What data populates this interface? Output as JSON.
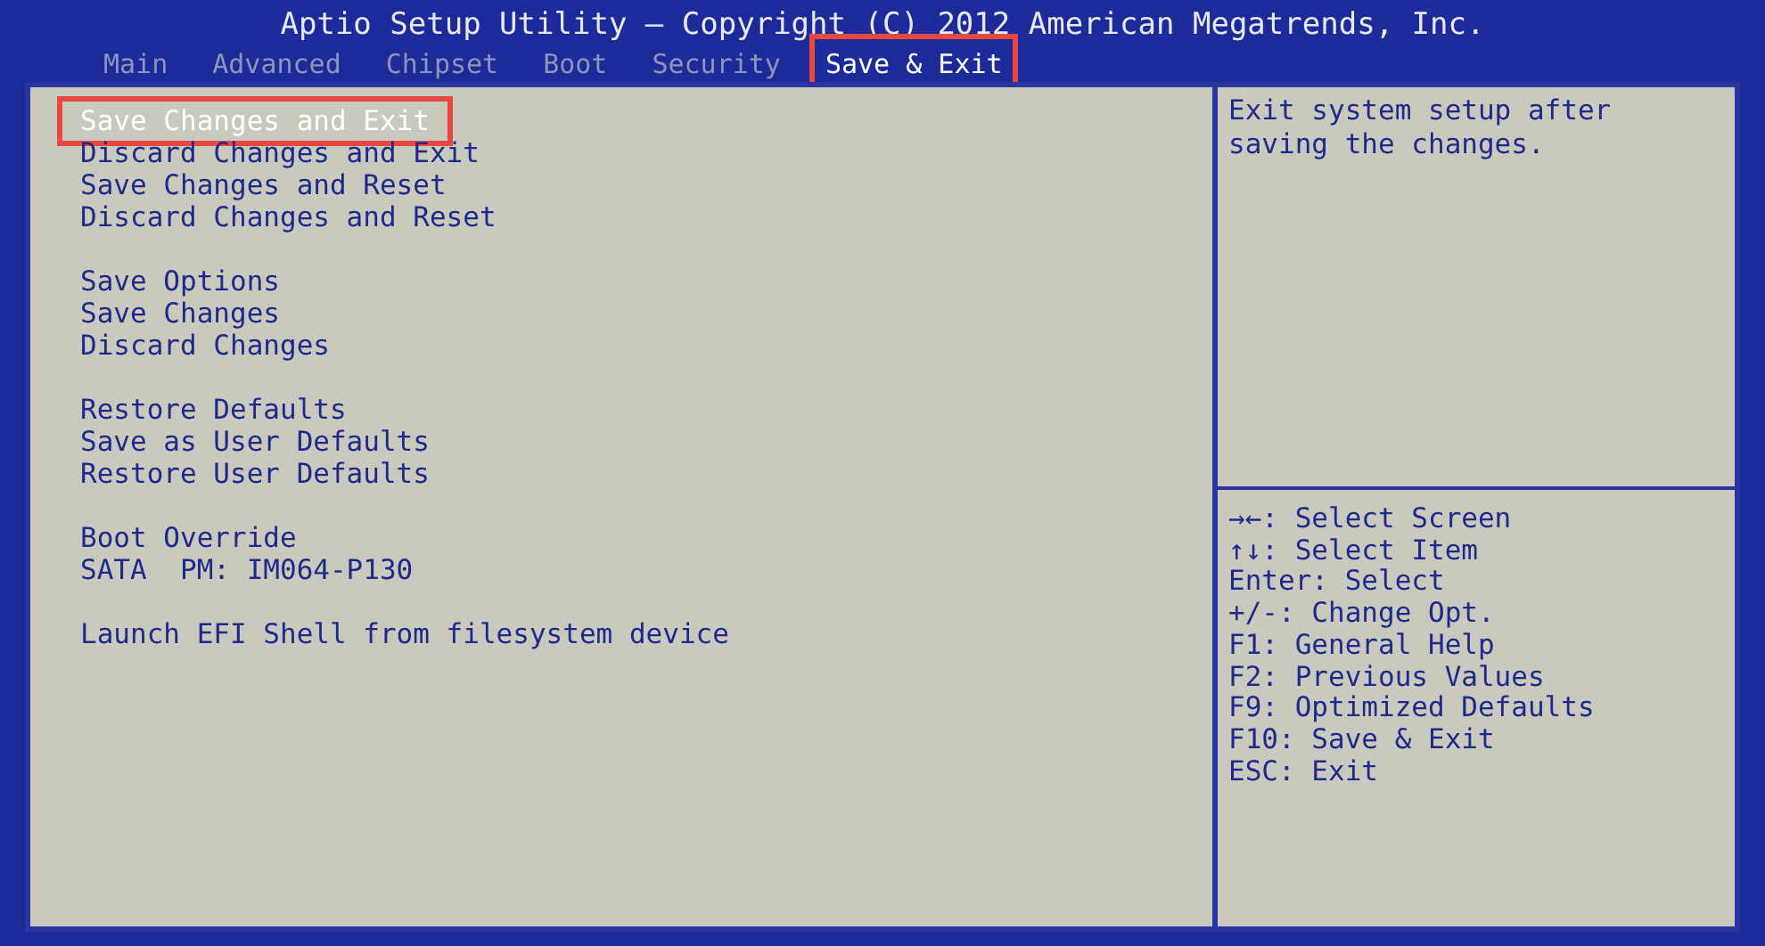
{
  "window": {
    "title": "Aptio Setup Utility – Copyright (C) 2012 American Megatrends, Inc."
  },
  "tabs": [
    {
      "label": "Main",
      "selected": false,
      "annotated": false
    },
    {
      "label": "Advanced",
      "selected": false,
      "annotated": false
    },
    {
      "label": "Chipset",
      "selected": false,
      "annotated": false
    },
    {
      "label": "Boot",
      "selected": false,
      "annotated": false
    },
    {
      "label": "Security",
      "selected": false,
      "annotated": false
    },
    {
      "label": "Save & Exit",
      "selected": true,
      "annotated": true
    }
  ],
  "menu_groups": [
    {
      "items": [
        {
          "label": "Save Changes and Exit",
          "selected": true,
          "annotated": true
        },
        {
          "label": "Discard Changes and Exit",
          "selected": false,
          "annotated": false
        },
        {
          "label": "Save Changes and Reset",
          "selected": false,
          "annotated": false
        },
        {
          "label": "Discard Changes and Reset",
          "selected": false,
          "annotated": false
        }
      ]
    },
    {
      "items": [
        {
          "label": "Save Options",
          "selected": false,
          "annotated": false
        },
        {
          "label": "Save Changes",
          "selected": false,
          "annotated": false
        },
        {
          "label": "Discard Changes",
          "selected": false,
          "annotated": false
        }
      ]
    },
    {
      "items": [
        {
          "label": "Restore Defaults",
          "selected": false,
          "annotated": false
        },
        {
          "label": "Save as User Defaults",
          "selected": false,
          "annotated": false
        },
        {
          "label": "Restore User Defaults",
          "selected": false,
          "annotated": false
        }
      ]
    },
    {
      "items": [
        {
          "label": "Boot Override",
          "selected": false,
          "annotated": false
        },
        {
          "label": "SATA  PM: IM064-P130",
          "selected": false,
          "annotated": false
        }
      ]
    },
    {
      "items": [
        {
          "label": "Launch EFI Shell from filesystem device",
          "selected": false,
          "annotated": false
        }
      ]
    }
  ],
  "description": "Exit system setup after saving the changes.",
  "help": [
    "→←: Select Screen",
    "↑↓: Select Item",
    "Enter: Select",
    "+/-: Change Opt.",
    "F1: General Help",
    "F2: Previous Values",
    "F9: Optimized Defaults",
    "F10: Save & Exit",
    "ESC: Exit"
  ]
}
